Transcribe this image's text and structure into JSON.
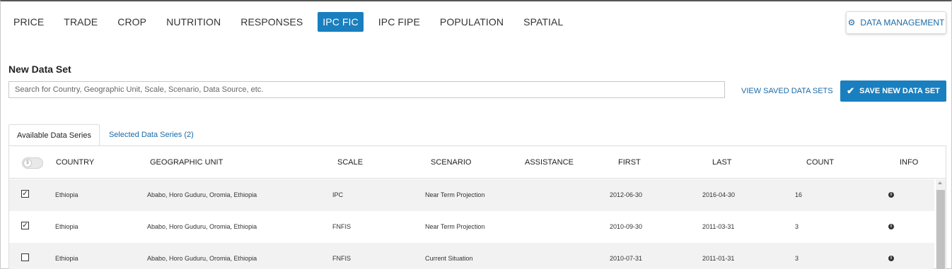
{
  "nav": {
    "items": [
      "PRICE",
      "TRADE",
      "CROP",
      "NUTRITION",
      "RESPONSES",
      "IPC FIC",
      "IPC FIPE",
      "POPULATION",
      "SPATIAL"
    ],
    "active": "IPC FIC",
    "data_management": "DATA MANAGEMENT"
  },
  "new_data_set": {
    "title": "New Data Set",
    "search_placeholder": "Search for Country, Geographic Unit, Scale, Scenario, Data Source, etc.",
    "view_saved": "VIEW SAVED DATA SETS",
    "save_button": "SAVE NEW DATA SET"
  },
  "tabs": {
    "available": "Available Data Series",
    "selected": "Selected Data Series (2)"
  },
  "table": {
    "toggle_label": "$",
    "headers": {
      "country": "COUNTRY",
      "geographic_unit": "GEOGRAPHIC UNIT",
      "scale": "SCALE",
      "scenario": "SCENARIO",
      "assistance": "ASSISTANCE",
      "first": "FIRST",
      "last": "LAST",
      "count": "COUNT",
      "info": "INFO"
    },
    "rows": [
      {
        "checked": true,
        "country": "Ethiopia",
        "geographic_unit": "Ababo, Horo Guduru, Oromia, Ethiopia",
        "scale": "IPC",
        "scenario": "Near Term Projection",
        "assistance": "",
        "first": "2012-06-30",
        "last": "2016-04-30",
        "count": "16"
      },
      {
        "checked": true,
        "country": "Ethiopia",
        "geographic_unit": "Ababo, Horo Guduru, Oromia, Ethiopia",
        "scale": "FNFIS",
        "scenario": "Near Term Projection",
        "assistance": "",
        "first": "2010-09-30",
        "last": "2011-03-31",
        "count": "3"
      },
      {
        "checked": false,
        "country": "Ethiopia",
        "geographic_unit": "Ababo, Horo Guduru, Oromia, Ethiopia",
        "scale": "FNFIS",
        "scenario": "Current Situation",
        "assistance": "",
        "first": "2010-07-31",
        "last": "2011-01-31",
        "count": "3"
      }
    ]
  },
  "colors": {
    "accent": "#1a7fbf",
    "link": "#1a6aa8",
    "row_shade": "#f2f2f2"
  },
  "icons": {
    "gear": "gear-icon",
    "check": "check-icon",
    "info": "info-icon"
  }
}
